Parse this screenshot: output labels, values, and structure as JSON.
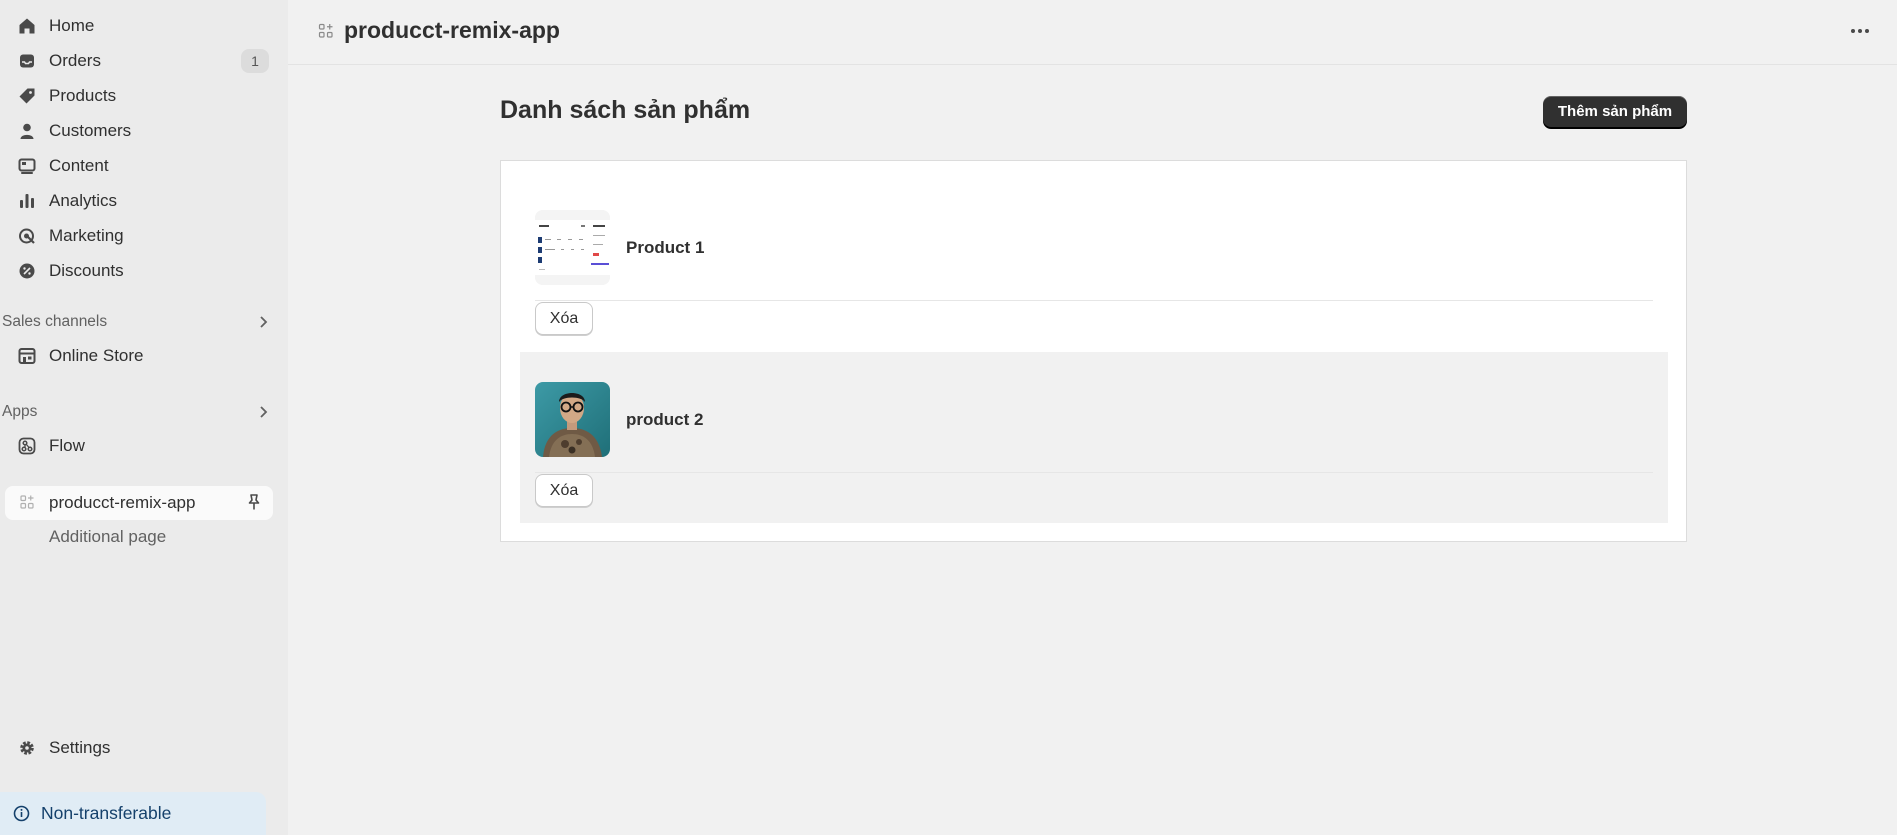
{
  "sidebar": {
    "items": [
      {
        "label": "Home",
        "icon": "home-icon"
      },
      {
        "label": "Orders",
        "icon": "inbox-icon",
        "badge": "1"
      },
      {
        "label": "Products",
        "icon": "tag-icon"
      },
      {
        "label": "Customers",
        "icon": "person-icon"
      },
      {
        "label": "Content",
        "icon": "content-icon"
      },
      {
        "label": "Analytics",
        "icon": "bar-chart-icon"
      },
      {
        "label": "Marketing",
        "icon": "target-icon"
      },
      {
        "label": "Discounts",
        "icon": "discount-icon"
      }
    ],
    "sales_channels": {
      "heading": "Sales channels",
      "items": [
        {
          "label": "Online Store",
          "icon": "store-icon"
        }
      ]
    },
    "apps": {
      "heading": "Apps",
      "items": [
        {
          "label": "Flow",
          "icon": "flow-icon"
        }
      ]
    },
    "pinned_app": {
      "label": "producct-remix-app",
      "sub_item": "Additional page"
    },
    "settings": {
      "label": "Settings"
    },
    "notice": {
      "label": "Non-transferable"
    }
  },
  "topbar": {
    "title": "producct-remix-app"
  },
  "main": {
    "title": "Danh sách sản phẩm",
    "add_button": "Thêm sản phẩm",
    "products": [
      {
        "name": "Product 1",
        "delete_label": "Xóa"
      },
      {
        "name": "product 2",
        "delete_label": "Xóa"
      }
    ]
  },
  "colors": {
    "primary_button": "#303030",
    "sidebar_bg": "#ebebeb",
    "page_bg": "#f1f1f1",
    "notice_bg": "#e0ecf5"
  }
}
